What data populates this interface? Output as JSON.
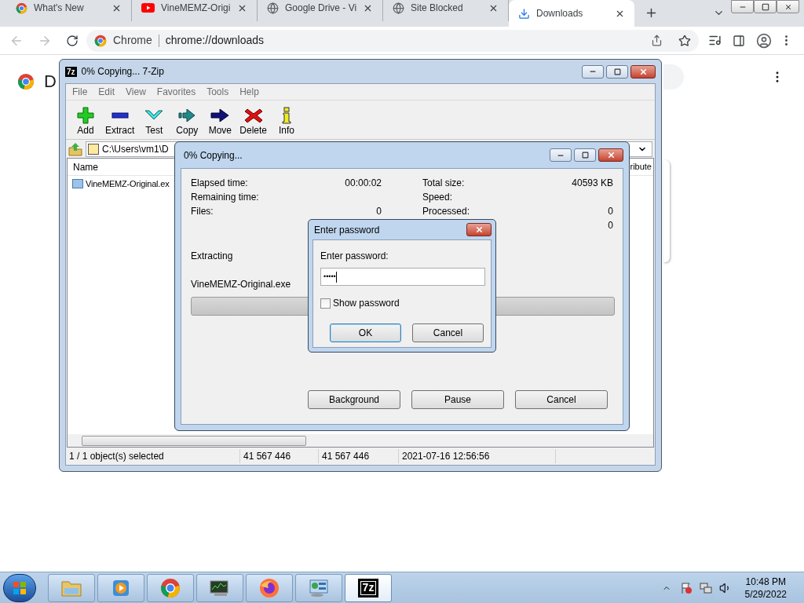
{
  "browser": {
    "tabs": [
      {
        "title": "What's New",
        "kind": "chrome",
        "selected": false
      },
      {
        "title": "VineMEMZ-Origi",
        "kind": "youtube",
        "selected": false
      },
      {
        "title": "Google Drive - Vi",
        "kind": "globe",
        "selected": false
      },
      {
        "title": "Site Blocked",
        "kind": "globe",
        "selected": false
      },
      {
        "title": "Downloads",
        "kind": "download",
        "selected": true
      }
    ],
    "address": {
      "label": "Chrome",
      "url": "chrome://downloads"
    }
  },
  "page": {
    "heading": "D"
  },
  "zip_window": {
    "title": "0% Copying... 7-Zip",
    "logo": "7z",
    "menu": [
      "File",
      "Edit",
      "View",
      "Favorites",
      "Tools",
      "Help"
    ],
    "toolbar": [
      {
        "label": "Add",
        "kind": "add"
      },
      {
        "label": "Extract",
        "kind": "extract"
      },
      {
        "label": "Test",
        "kind": "test"
      },
      {
        "label": "Copy",
        "kind": "copy"
      },
      {
        "label": "Move",
        "kind": "move"
      },
      {
        "label": "Delete",
        "kind": "delete"
      },
      {
        "label": "Info",
        "kind": "info"
      }
    ],
    "path": "C:\\Users\\vm1\\D",
    "columns": [
      "Name",
      "ribute"
    ],
    "rows": [
      {
        "name": "VineMEMZ-Original.ex"
      }
    ],
    "status": [
      "1 / 1 object(s) selected",
      "41 567 446",
      "41 567 446",
      "2021-07-16 12:56:56"
    ]
  },
  "progress_dialog": {
    "title": "0% Copying...",
    "left": [
      {
        "label": "Elapsed time:",
        "value": "00:00:02"
      },
      {
        "label": "Remaining time:"
      },
      {
        "label": "Files:",
        "value": "0"
      }
    ],
    "right": [
      {
        "label": "Total size:",
        "value": "40593 KB"
      },
      {
        "label": "Speed:"
      },
      {
        "label": "Processed:",
        "value": "0"
      },
      {
        "value": "0"
      }
    ],
    "operation": "Extracting",
    "file": "VineMEMZ-Original.exe",
    "progress": {
      "level": 0
    },
    "buttons": [
      "Background",
      "Pause",
      "Cancel"
    ]
  },
  "password_dialog": {
    "title": "Enter password",
    "label": "Enter password:",
    "value": "•••••",
    "show_password": {
      "label": "Show password",
      "checked": false
    },
    "buttons": [
      {
        "label": "OK",
        "default": true
      },
      {
        "label": "Cancel",
        "default": false
      }
    ]
  },
  "taskbar": {
    "apps": [
      {
        "kind": "explorer",
        "selected": false
      },
      {
        "kind": "media",
        "selected": false
      },
      {
        "kind": "chrome",
        "selected": false
      },
      {
        "kind": "monitor",
        "selected": false
      },
      {
        "kind": "firefox",
        "selected": false
      },
      {
        "kind": "control",
        "selected": false
      },
      {
        "kind": "zip",
        "text": "7z",
        "selected": true
      }
    ],
    "clock": {
      "time": "10:48 PM",
      "date": "5/29/2022"
    }
  }
}
